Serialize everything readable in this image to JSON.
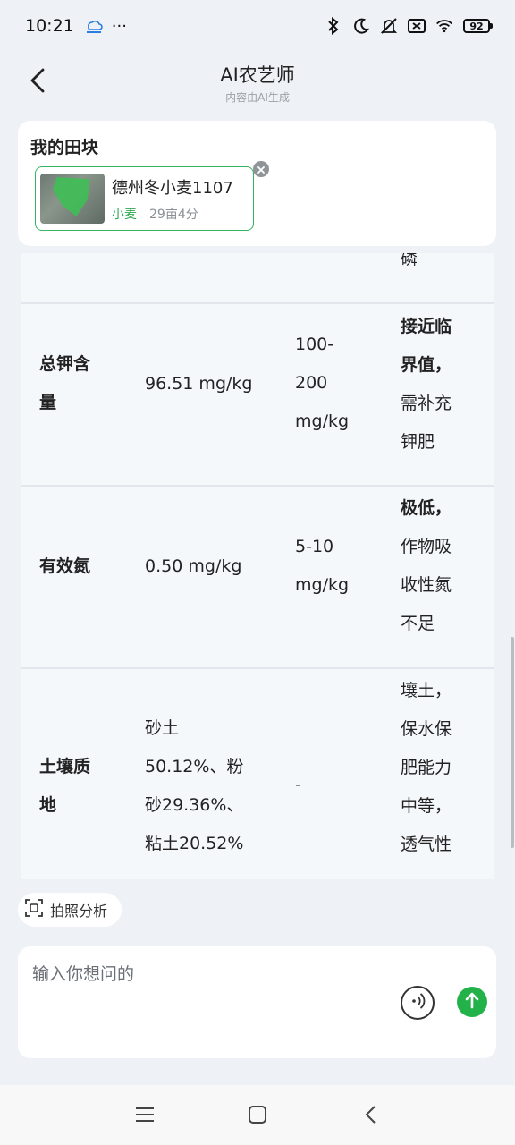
{
  "status_bar": {
    "time": "10:21",
    "more": "···",
    "battery": "92",
    "icons": [
      "bluetooth-icon",
      "moon-icon",
      "mute-icon",
      "sim-icon",
      "wifi-icon",
      "battery-icon"
    ]
  },
  "header": {
    "title": "AI农艺师",
    "subtitle": "内容由AI生成",
    "back_icon": "chevron-left-icon"
  },
  "field_card": {
    "title": "我的田块",
    "plot": {
      "name": "德州冬小麦1107",
      "crop": "小麦",
      "area": "29亩4分"
    }
  },
  "table": {
    "rows": [
      {
        "name": [],
        "value": [],
        "range": [],
        "note": [
          {
            "text": "磷",
            "bold": false
          }
        ]
      },
      {
        "name": [
          "总钾含",
          "量"
        ],
        "value": [
          "96.51 mg/kg"
        ],
        "range": [
          "100-",
          "200",
          "mg/kg"
        ],
        "note": [
          {
            "text": "接近临",
            "bold": true
          },
          {
            "text": "界值，",
            "bold": true
          },
          {
            "text": "需补充",
            "bold": false
          },
          {
            "text": "钾肥",
            "bold": false
          }
        ]
      },
      {
        "name": [
          "有效氮"
        ],
        "value": [
          "0.50 mg/kg"
        ],
        "range": [
          "5-10",
          "mg/kg"
        ],
        "note": [
          {
            "text": "极低，",
            "bold": true
          },
          {
            "text": "作物吸",
            "bold": false
          },
          {
            "text": "收性氮",
            "bold": false
          },
          {
            "text": "不足",
            "bold": false
          }
        ]
      },
      {
        "name": [
          "土壤质",
          "地"
        ],
        "value": [
          "砂土",
          "50.12%、粉",
          "砂29.36%、",
          "粘土20.52%"
        ],
        "range": [
          "-"
        ],
        "note": [
          {
            "text": "壤土，",
            "bold": false
          },
          {
            "text": "保水保",
            "bold": false
          },
          {
            "text": "肥能力",
            "bold": false
          },
          {
            "text": "中等，",
            "bold": false
          },
          {
            "text": "透气性",
            "bold": false
          }
        ]
      }
    ]
  },
  "photo_button": {
    "label": "拍照分析"
  },
  "input": {
    "placeholder": "输入你想问的"
  },
  "colors": {
    "accent": "#23b24a",
    "crop_label": "#2fa84f",
    "background": "#eef2f6"
  }
}
